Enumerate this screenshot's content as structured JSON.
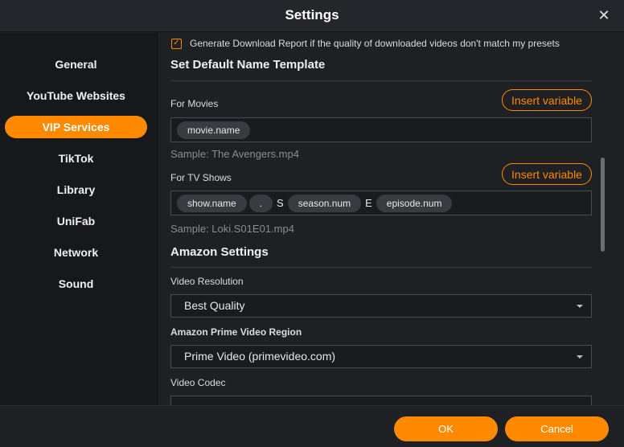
{
  "window": {
    "title": "Settings",
    "close_glyph": "✕"
  },
  "sidebar": {
    "items": [
      {
        "label": "General",
        "active": false
      },
      {
        "label": "YouTube Websites",
        "active": false
      },
      {
        "label": "VIP Services",
        "active": true
      },
      {
        "label": "TikTok",
        "active": false
      },
      {
        "label": "Library",
        "active": false
      },
      {
        "label": "UniFab",
        "active": false
      },
      {
        "label": "Network",
        "active": false
      },
      {
        "label": "Sound",
        "active": false
      }
    ]
  },
  "main": {
    "report_checkbox": {
      "checked": true,
      "label": "Generate Download Report if the quality of downloaded videos don't match my presets"
    },
    "name_template": {
      "title": "Set Default Name Template",
      "movies": {
        "label": "For Movies",
        "insert_label": "Insert variable",
        "chips": [
          "movie.name"
        ],
        "sample": "Sample: The Avengers.mp4"
      },
      "tv": {
        "label": "For TV Shows",
        "insert_label": "Insert variable",
        "chip1": "show.name",
        "chip2": ".",
        "sep1": "S",
        "chip3": "season.num",
        "sep2": "E",
        "chip4": "episode.num",
        "sample": "Sample: Loki.S01E01.mp4"
      }
    },
    "amazon": {
      "title": "Amazon Settings",
      "resolution": {
        "label": "Video Resolution",
        "value": "Best Quality"
      },
      "region": {
        "label": "Amazon Prime Video Region",
        "value": "Prime Video (primevideo.com)"
      },
      "codec": {
        "label": "Video Codec",
        "value": ""
      }
    }
  },
  "footer": {
    "ok_label": "OK",
    "cancel_label": "Cancel"
  },
  "colors": {
    "accent": "#ff8a00",
    "background": "#1f2024",
    "sidebar": "#17181b"
  },
  "icons": {
    "close": "close-icon",
    "check": "checkmark-icon",
    "dropdown": "chevron-down-icon"
  }
}
